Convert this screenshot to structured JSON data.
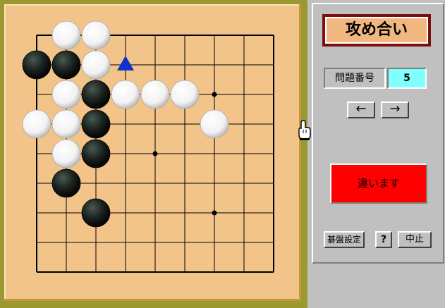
{
  "title": "攻め合い",
  "problem": {
    "label": "問題番号",
    "value": "5"
  },
  "nav": {
    "prev_label": "←",
    "next_label": "→"
  },
  "result": {
    "text": "違います",
    "color": "#ff0000"
  },
  "footer": {
    "setup_label": "碁盤設定",
    "help_label": "?",
    "stop_label": "中止"
  },
  "board": {
    "size": 9,
    "star_points": [
      [
        6,
        2
      ],
      [
        4,
        4
      ],
      [
        6,
        6
      ]
    ],
    "black": [
      [
        0,
        1
      ],
      [
        1,
        1
      ],
      [
        2,
        2
      ],
      [
        2,
        3
      ],
      [
        2,
        4
      ],
      [
        1,
        5
      ],
      [
        2,
        6
      ]
    ],
    "white": [
      [
        1,
        0
      ],
      [
        2,
        0
      ],
      [
        2,
        1
      ],
      [
        1,
        2
      ],
      [
        3,
        2
      ],
      [
        4,
        2
      ],
      [
        5,
        2
      ],
      [
        0,
        3
      ],
      [
        1,
        3
      ],
      [
        6,
        3
      ],
      [
        1,
        4
      ]
    ],
    "last_move_marker": [
      3,
      1
    ],
    "marker_color": "#1030d0"
  },
  "colors": {
    "board": "#f2c48a",
    "panel": "#c0c0c0",
    "title_frame": "#7a0f0f",
    "title_fill": "#f0b880",
    "counter_fill": "#80ffff"
  },
  "icons": [
    "pointing-hand-icon",
    "triangle-marker-icon"
  ]
}
